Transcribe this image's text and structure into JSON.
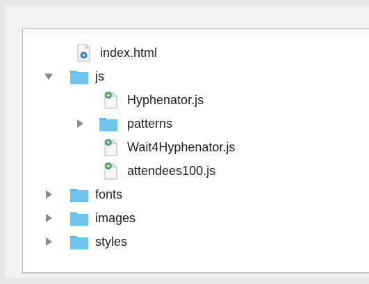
{
  "tree": {
    "items": [
      {
        "label": "index.html",
        "type": "html-file",
        "level": 1,
        "expanded": null
      },
      {
        "label": "js",
        "type": "folder",
        "level": 0,
        "expanded": true
      },
      {
        "label": "Hyphenator.js",
        "type": "js-file",
        "level": 2,
        "expanded": null
      },
      {
        "label": "patterns",
        "type": "folder",
        "level": 1,
        "expanded": false
      },
      {
        "label": "Wait4Hyphenator.js",
        "type": "js-file",
        "level": 2,
        "expanded": null
      },
      {
        "label": "attendees100.js",
        "type": "js-file",
        "level": 2,
        "expanded": null
      },
      {
        "label": "fonts",
        "type": "folder",
        "level": 0,
        "expanded": false
      },
      {
        "label": "images",
        "type": "folder",
        "level": 0,
        "expanded": false
      },
      {
        "label": "styles",
        "type": "folder",
        "level": 0,
        "expanded": false
      }
    ]
  },
  "colors": {
    "folder": "#6ec6f0",
    "folder_tab": "#5ab8e8",
    "disclosure": "#8a8a8a",
    "text": "#1e1e1e"
  }
}
